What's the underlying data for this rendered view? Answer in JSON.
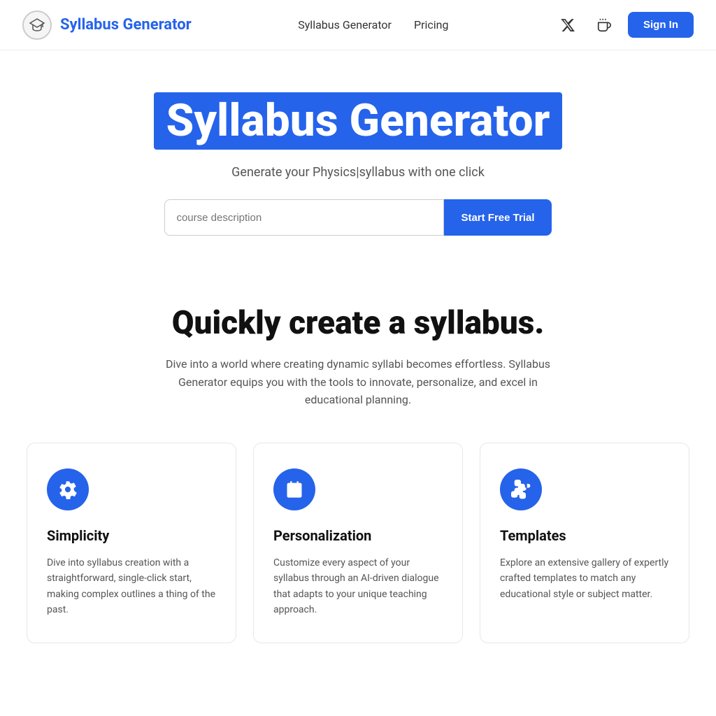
{
  "navbar": {
    "brand": "Syllabus Generator",
    "logo_alt": "graduation-cap-icon",
    "links": [
      {
        "label": "Syllabus Generator",
        "name": "nav-link-syllabus"
      },
      {
        "label": "Pricing",
        "name": "nav-link-pricing"
      }
    ],
    "twitter_icon": "twitter-icon",
    "coffee_icon": "coffee-icon",
    "signin_label": "Sign In"
  },
  "hero": {
    "title": "Syllabus Generator",
    "subtitle": "Generate your Physics|syllabus with one click",
    "input_placeholder": "course description",
    "cta_button": "Start Free Trial"
  },
  "features": {
    "heading": "Quickly create a syllabus.",
    "description": "Dive into a world where creating dynamic syllabi becomes effortless. Syllabus Generator equips you with the tools to innovate, personalize, and excel in educational planning.",
    "cards": [
      {
        "icon": "gear-icon",
        "title": "Simplicity",
        "text": "Dive into syllabus creation with a straightforward, single-click start, making complex outlines a thing of the past."
      },
      {
        "icon": "calendar-icon",
        "title": "Personalization",
        "text": "Customize every aspect of your syllabus through an AI-driven dialogue that adapts to your unique teaching approach."
      },
      {
        "icon": "puzzle-icon",
        "title": "Templates",
        "text": "Explore an extensive gallery of expertly crafted templates to match any educational style or subject matter."
      }
    ]
  }
}
